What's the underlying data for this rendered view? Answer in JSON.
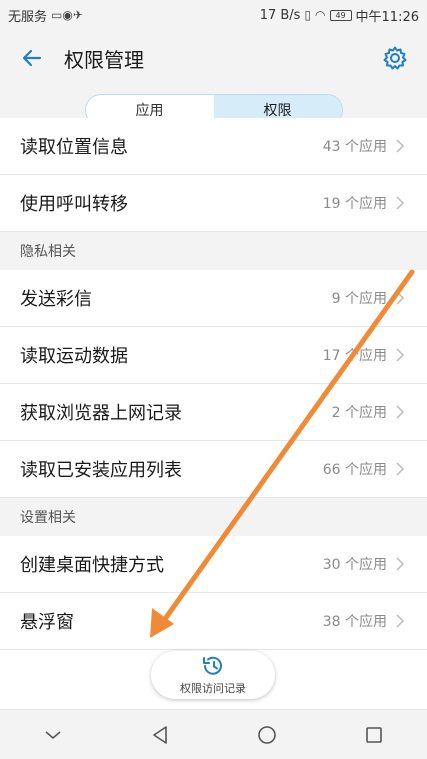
{
  "status_bar": {
    "carrier": "无服务",
    "network_speed": "17 B/s",
    "battery_level": "49",
    "time": "中午11:26"
  },
  "header": {
    "title": "权限管理"
  },
  "tabs": [
    {
      "label": "应用",
      "active": false
    },
    {
      "label": "权限",
      "active": true
    }
  ],
  "groups": [
    {
      "title": "",
      "items": [
        {
          "label": "读取位置信息",
          "count": "43 个应用"
        },
        {
          "label": "使用呼叫转移",
          "count": "19 个应用"
        }
      ]
    },
    {
      "title": "隐私相关",
      "items": [
        {
          "label": "发送彩信",
          "count": "9 个应用"
        },
        {
          "label": "读取运动数据",
          "count": "17 个应用"
        },
        {
          "label": "获取浏览器上网记录",
          "count": "2 个应用"
        },
        {
          "label": "读取已安装应用列表",
          "count": "66 个应用"
        }
      ]
    },
    {
      "title": "设置相关",
      "items": [
        {
          "label": "创建桌面快捷方式",
          "count": "30 个应用"
        },
        {
          "label": "悬浮窗",
          "count": "38 个应用"
        }
      ]
    }
  ],
  "floating_button": {
    "label": "权限访问记录",
    "icon": "history-clock-icon"
  },
  "nav_bar": {
    "icons": [
      "collapse-chevron-icon",
      "back-triangle-icon",
      "home-circle-icon",
      "recents-square-icon"
    ]
  },
  "colors": {
    "accent": "#1f7fc4",
    "arrow_annotation": "#f08a36",
    "tab_active_bg": "#d6ecf8"
  }
}
